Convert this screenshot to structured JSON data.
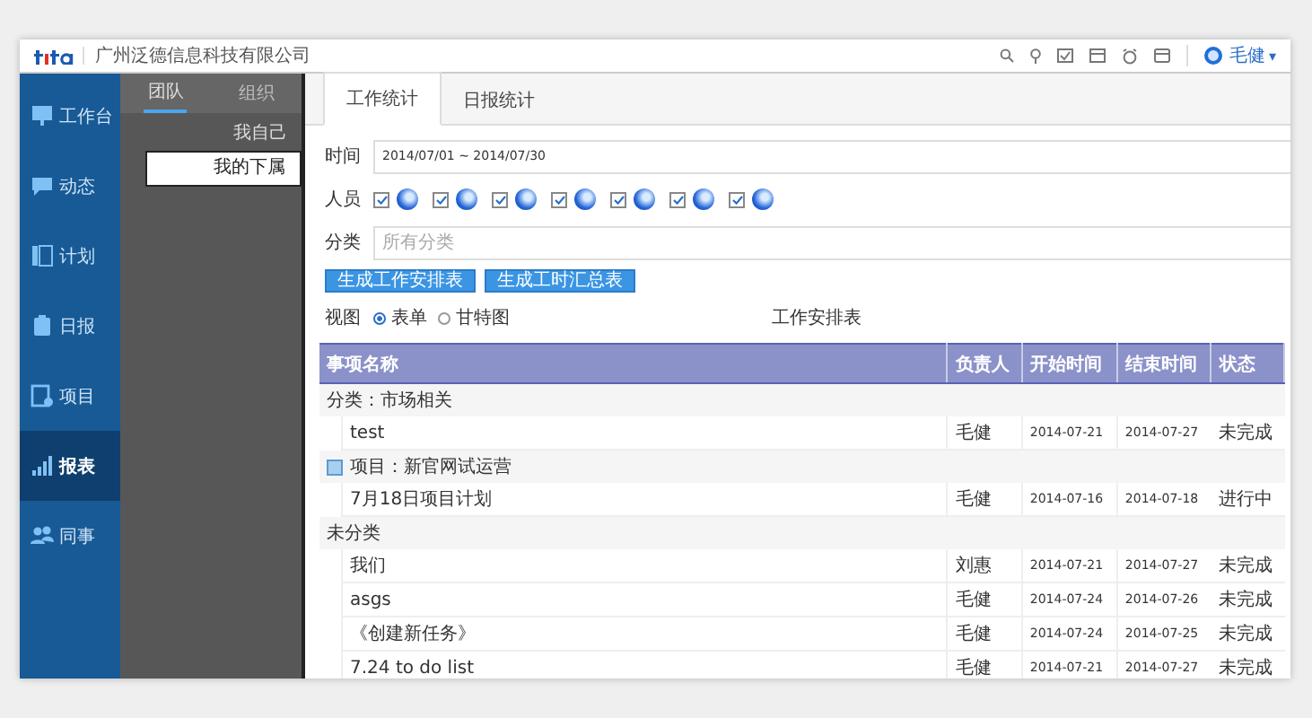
{
  "topbar": {
    "company": "广州泛德信息科技有限公司",
    "user": "毛健",
    "caret": "▾"
  },
  "nav": [
    {
      "label": "工作台",
      "selected": false
    },
    {
      "label": "动态",
      "selected": false
    },
    {
      "label": "计划",
      "selected": false
    },
    {
      "label": "日报",
      "selected": false
    },
    {
      "label": "项目",
      "selected": false
    },
    {
      "label": "报表",
      "selected": true
    },
    {
      "label": "同事",
      "selected": false
    }
  ],
  "subnav": {
    "tabs": [
      {
        "label": "团队",
        "selected": true
      },
      {
        "label": "组织",
        "selected": false
      }
    ],
    "items": [
      {
        "label": "我自己",
        "selected": false
      },
      {
        "label": "我的下属",
        "selected": true
      }
    ]
  },
  "tabs": [
    {
      "label": "工作统计",
      "selected": true
    },
    {
      "label": "日报统计",
      "selected": false
    }
  ],
  "filters": {
    "time_label": "时间",
    "time_value": "2014/07/01 ~ 2014/07/30",
    "people_label": "人员",
    "people": [
      {
        "checked": true
      },
      {
        "checked": true
      },
      {
        "checked": true
      },
      {
        "checked": true
      },
      {
        "checked": true
      },
      {
        "checked": true
      },
      {
        "checked": true
      }
    ],
    "category_label": "分类",
    "category_placeholder": "所有分类"
  },
  "buttons": [
    "生成工作安排表",
    "生成工时汇总表"
  ],
  "view": {
    "label": "视图",
    "options": [
      {
        "label": "表单",
        "selected": true
      },
      {
        "label": "甘特图",
        "selected": false
      }
    ]
  },
  "table": {
    "title": "工作安排表",
    "columns": [
      "事项名称",
      "负责人",
      "开始时间",
      "结束时间",
      "状态"
    ],
    "rows": [
      {
        "kind": "group",
        "label": "分类：市场相关"
      },
      {
        "kind": "task",
        "cells": [
          "test",
          "毛健",
          "2014-07-21",
          "2014-07-27",
          "未完成"
        ]
      },
      {
        "kind": "project",
        "label": "项目：新官网试运营"
      },
      {
        "kind": "task",
        "cells": [
          "7月18日项目计划",
          "毛健",
          "2014-07-16",
          "2014-07-18",
          "进行中"
        ]
      },
      {
        "kind": "group",
        "label": "未分类"
      },
      {
        "kind": "task",
        "cells": [
          "我们",
          "刘惠",
          "2014-07-21",
          "2014-07-27",
          "未完成"
        ]
      },
      {
        "kind": "task",
        "cells": [
          "asgs",
          "毛健",
          "2014-07-24",
          "2014-07-26",
          "未完成"
        ]
      },
      {
        "kind": "task",
        "cells": [
          "《创建新任务》",
          "毛健",
          "2014-07-24",
          "2014-07-25",
          "未完成"
        ]
      },
      {
        "kind": "task",
        "cells": [
          "7.24 to do list",
          "毛健",
          "2014-07-21",
          "2014-07-27",
          "未完成"
        ]
      }
    ]
  }
}
